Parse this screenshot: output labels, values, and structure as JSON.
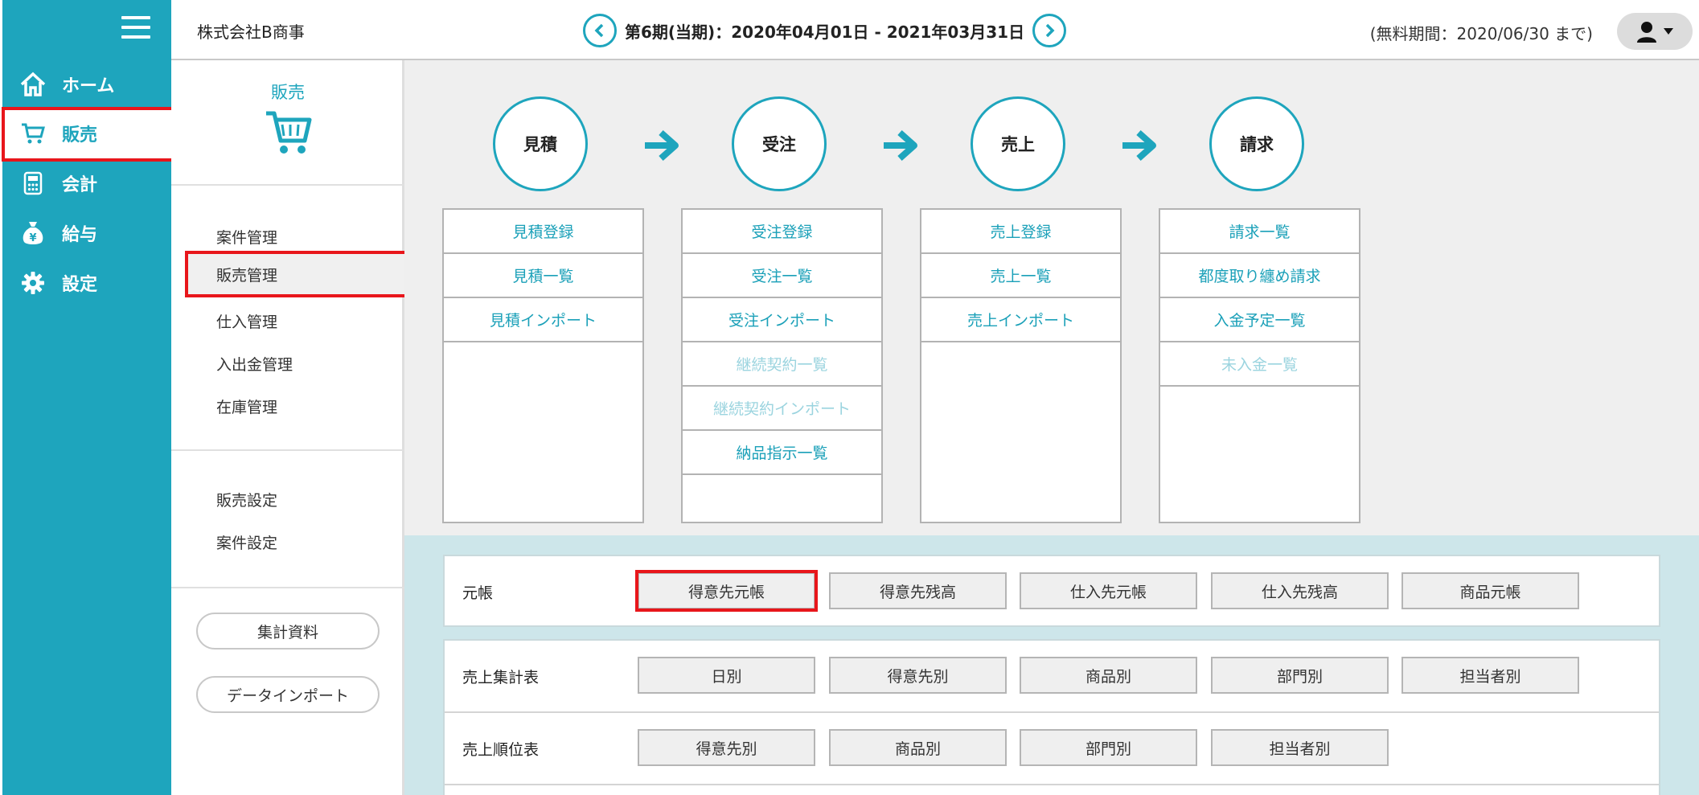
{
  "nav": {
    "items": [
      {
        "label": "ホーム",
        "icon": "home-icon"
      },
      {
        "label": "販売",
        "icon": "cart-icon"
      },
      {
        "label": "会計",
        "icon": "calculator-icon"
      },
      {
        "label": "給与",
        "icon": "money-bag-icon"
      },
      {
        "label": "設定",
        "icon": "gear-icon"
      }
    ],
    "active_index": 1
  },
  "header": {
    "company": "株式会社B商事",
    "period": "第6期(当期)：2020年04月01日 - 2021年03月31日",
    "trial": "(無料期間：2020/06/30 まで)"
  },
  "submenu": {
    "title": "販売",
    "group1": [
      "案件管理",
      "販売管理",
      "仕入管理",
      "入出金管理",
      "在庫管理"
    ],
    "group2": [
      "販売設定",
      "案件設定"
    ],
    "buttons": [
      "集計資料",
      "データインポート"
    ],
    "active": "販売管理"
  },
  "flow": {
    "steps": [
      "見積",
      "受注",
      "売上",
      "請求"
    ],
    "columns": [
      {
        "rows": [
          {
            "label": "見積登録",
            "enabled": true
          },
          {
            "label": "見積一覧",
            "enabled": true
          },
          {
            "label": "見積インポート",
            "enabled": true
          }
        ]
      },
      {
        "rows": [
          {
            "label": "受注登録",
            "enabled": true
          },
          {
            "label": "受注一覧",
            "enabled": true
          },
          {
            "label": "受注インポート",
            "enabled": true
          },
          {
            "label": "継続契約一覧",
            "enabled": false
          },
          {
            "label": "継続契約インポート",
            "enabled": false
          },
          {
            "label": "納品指示一覧",
            "enabled": true
          }
        ]
      },
      {
        "rows": [
          {
            "label": "売上登録",
            "enabled": true
          },
          {
            "label": "売上一覧",
            "enabled": true
          },
          {
            "label": "売上インポート",
            "enabled": true
          }
        ]
      },
      {
        "rows": [
          {
            "label": "請求一覧",
            "enabled": true
          },
          {
            "label": "都度取り纏め請求",
            "enabled": true
          },
          {
            "label": "入金予定一覧",
            "enabled": true
          },
          {
            "label": "未入金一覧",
            "enabled": false
          }
        ]
      }
    ]
  },
  "reports": {
    "ledger": {
      "label": "元帳",
      "buttons": [
        "得意先元帳",
        "得意先残高",
        "仕入先元帳",
        "仕入先残高",
        "商品元帳"
      ]
    },
    "sales_summary": {
      "label": "売上集計表",
      "buttons": [
        "日別",
        "得意先別",
        "商品別",
        "部門別",
        "担当者別"
      ]
    },
    "sales_ranking": {
      "label": "売上順位表",
      "buttons": [
        "得意先別",
        "商品別",
        "部門別",
        "担当者別"
      ]
    }
  },
  "colors": {
    "accent": "#1ea5bd",
    "highlight": "#e8161b",
    "disabled": "#9bd4df"
  }
}
